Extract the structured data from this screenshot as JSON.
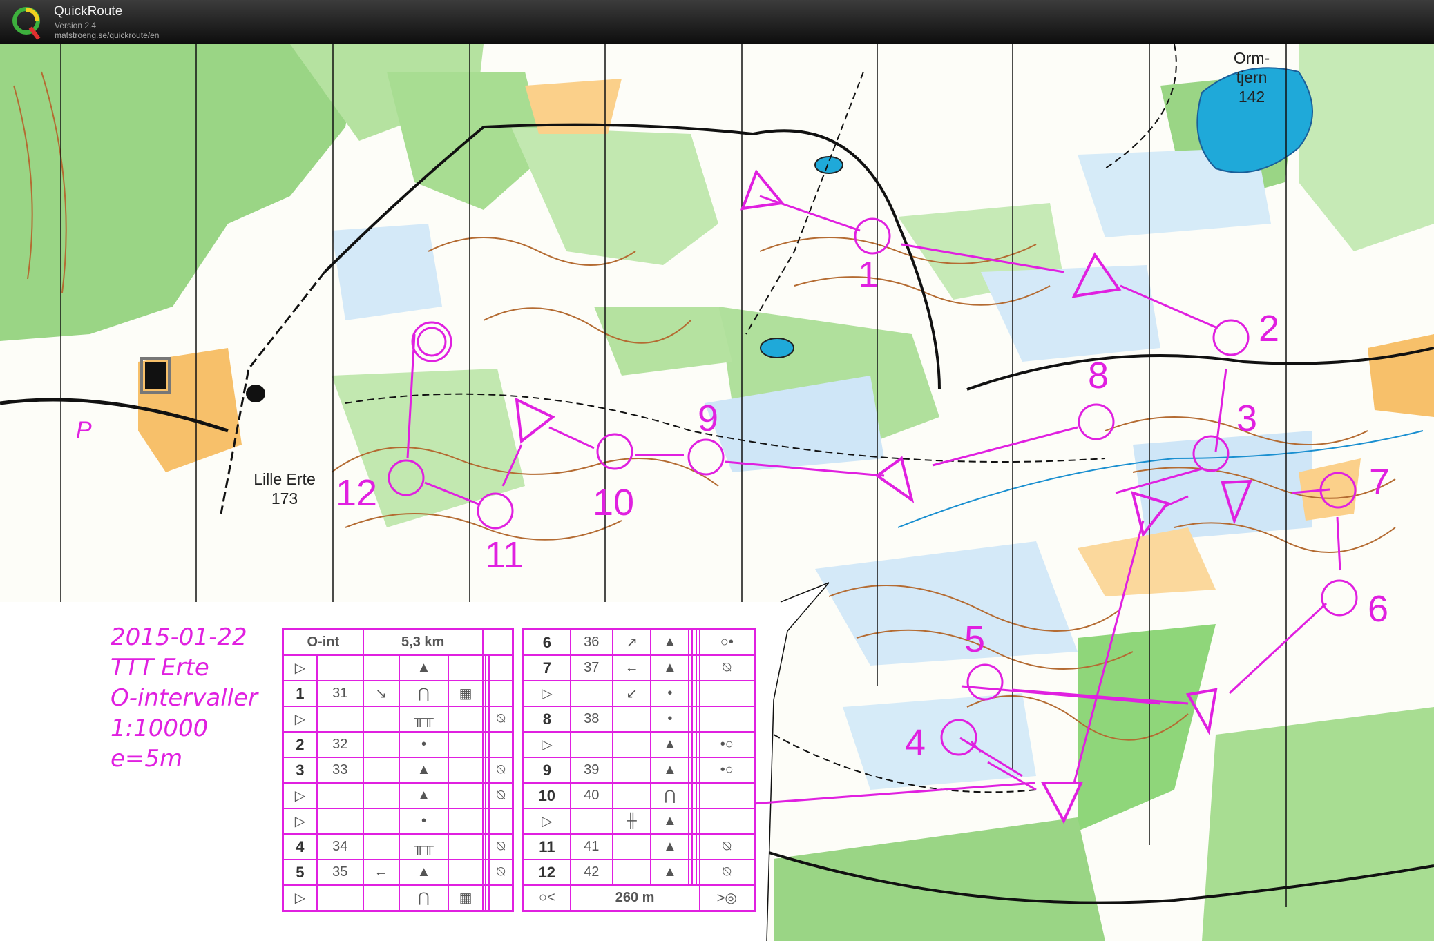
{
  "app": {
    "title": "QuickRoute",
    "version": "Version 2.4",
    "url": "matstroeng.se/quickroute/en",
    "logo_letter": "Q"
  },
  "map": {
    "place_labels": [
      {
        "name": "Orm-",
        "line2": "tjern",
        "line3": "142"
      },
      {
        "name": "Lille Erte",
        "line2": "173"
      }
    ],
    "parking_symbol": "P",
    "colors": {
      "course": "#e020e0",
      "open": "#f7c06a",
      "forest_green": "#8fd67a",
      "water": "#1fa9d9",
      "contour": "#b46b32",
      "marsh": "#4aa0e0"
    }
  },
  "course_info": {
    "date": "2015-01-22",
    "club": "TTT Erte",
    "event": "O-intervaller",
    "scale": "1:10000",
    "equidistance": "e=5m"
  },
  "course": {
    "controls": [
      {
        "label": "1"
      },
      {
        "label": "2"
      },
      {
        "label": "3"
      },
      {
        "label": "4"
      },
      {
        "label": "5"
      },
      {
        "label": "6"
      },
      {
        "label": "7"
      },
      {
        "label": "8"
      },
      {
        "label": "9"
      },
      {
        "label": "10"
      },
      {
        "label": "11"
      },
      {
        "label": "12"
      }
    ]
  },
  "descriptions": {
    "left": {
      "header": [
        "O-int",
        "5,3 km",
        ""
      ],
      "rows": [
        {
          "n": "▷",
          "code": "",
          "dir": "",
          "feat": "▲",
          "detail": "",
          "extra": ""
        },
        {
          "n": "1",
          "code": "31",
          "dir": "↘",
          "feat": "⋂",
          "detail": "▦",
          "extra": ""
        },
        {
          "n": "▷",
          "code": "",
          "dir": "",
          "feat": "╥╥",
          "detail": "",
          "extra": "⍉"
        },
        {
          "n": "2",
          "code": "32",
          "dir": "",
          "feat": "•",
          "detail": "",
          "extra": ""
        },
        {
          "n": "3",
          "code": "33",
          "dir": "",
          "feat": "▲",
          "detail": "",
          "extra": "⍉"
        },
        {
          "n": "▷",
          "code": "",
          "dir": "",
          "feat": "▲",
          "detail": "",
          "extra": "⍉"
        },
        {
          "n": "▷",
          "code": "",
          "dir": "",
          "feat": "•",
          "detail": "",
          "extra": ""
        },
        {
          "n": "4",
          "code": "34",
          "dir": "",
          "feat": "╥╥",
          "detail": "",
          "extra": "⍉"
        },
        {
          "n": "5",
          "code": "35",
          "dir": "←",
          "feat": "▲",
          "detail": "",
          "extra": "⍉"
        },
        {
          "n": "▷",
          "code": "",
          "dir": "",
          "feat": "⋂",
          "detail": "▦",
          "extra": ""
        }
      ]
    },
    "right": {
      "rows": [
        {
          "n": "6",
          "code": "36",
          "dir": "↗",
          "feat": "▲",
          "detail": "",
          "extra": "○•"
        },
        {
          "n": "7",
          "code": "37",
          "dir": "←",
          "feat": "▲",
          "detail": "",
          "extra": "⍉"
        },
        {
          "n": "▷",
          "code": "",
          "dir": "↙",
          "feat": "•",
          "detail": "",
          "extra": ""
        },
        {
          "n": "8",
          "code": "38",
          "dir": "",
          "feat": "•",
          "detail": "",
          "extra": ""
        },
        {
          "n": "▷",
          "code": "",
          "dir": "",
          "feat": "▲",
          "detail": "",
          "extra": "•○"
        },
        {
          "n": "9",
          "code": "39",
          "dir": "",
          "feat": "▲",
          "detail": "",
          "extra": "•○"
        },
        {
          "n": "10",
          "code": "40",
          "dir": "",
          "feat": "⋂",
          "detail": "",
          "extra": ""
        },
        {
          "n": "▷",
          "code": "",
          "dir": "╫",
          "feat": "▲",
          "detail": "",
          "extra": ""
        },
        {
          "n": "11",
          "code": "41",
          "dir": "",
          "feat": "▲",
          "detail": "",
          "extra": "⍉"
        },
        {
          "n": "12",
          "code": "42",
          "dir": "",
          "feat": "▲",
          "detail": "",
          "extra": "⍉"
        }
      ],
      "footer": {
        "start": "○<",
        "distance": "260 m",
        "finish": ">◎"
      }
    }
  }
}
